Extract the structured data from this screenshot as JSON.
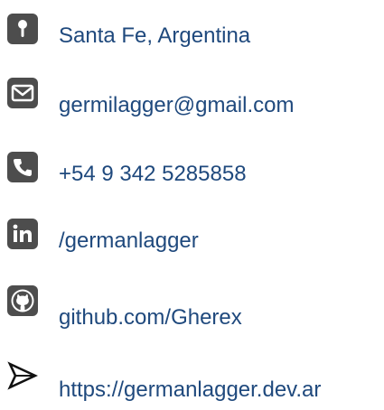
{
  "theme": {
    "text_color": "#1f497d",
    "icon_color": "#4d4d4d"
  },
  "contacts": [
    {
      "icon": "location-pin-icon",
      "label": "Santa Fe, Argentina"
    },
    {
      "icon": "envelope-icon",
      "label": "germilagger@gmail.com"
    },
    {
      "icon": "phone-icon",
      "label": "+54 9 342 5285858"
    },
    {
      "icon": "linkedin-icon",
      "label": "/germanlagger"
    },
    {
      "icon": "github-icon",
      "label": "github.com/Gherex"
    },
    {
      "icon": "arrow-pointer-icon",
      "label": "https://germanlagger.dev.ar"
    }
  ]
}
